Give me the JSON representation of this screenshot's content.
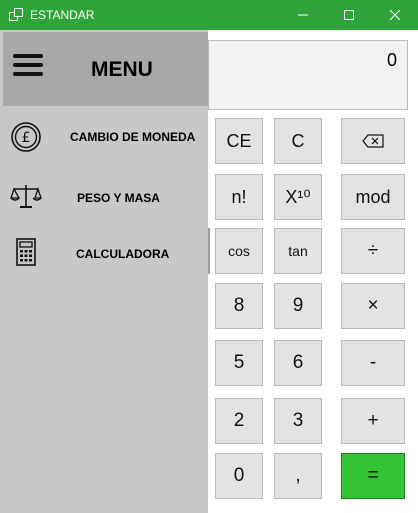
{
  "window": {
    "title": "ESTANDAR",
    "accent": "#2ea43a"
  },
  "display": {
    "value": "0"
  },
  "keypad": {
    "ce": "CE",
    "c": "C",
    "backspace_icon": "backspace-icon",
    "factorial": "n!",
    "pow10": "X¹⁰",
    "mod": "mod",
    "cos": "cos",
    "tan": "tan",
    "divide": "÷",
    "k8": "8",
    "k9": "9",
    "multiply": "×",
    "k5": "5",
    "k6": "6",
    "minus": "-",
    "k2": "2",
    "k3": "3",
    "plus": "+",
    "k0": "0",
    "comma": ",",
    "equals": "=",
    "equals_color": "#34c334"
  },
  "menu": {
    "title": "MENU",
    "items": [
      {
        "label": "CAMBIO DE MONEDA",
        "icon": "pound-coin-icon"
      },
      {
        "label": "PESO Y MASA",
        "icon": "scale-icon"
      },
      {
        "label": "CALCULADORA",
        "icon": "calculator-icon"
      }
    ]
  }
}
